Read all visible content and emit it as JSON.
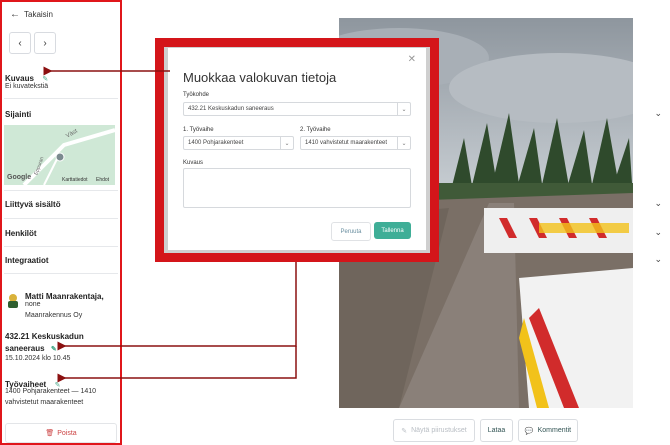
{
  "sidebar": {
    "back_label": "Takaisin",
    "kuvaus_title": "Kuvaus",
    "kuvaus_value": "Ei kuvatekstiä",
    "sijainti_title": "Sijainti",
    "map": {
      "street_label": "Väst",
      "street_label2": "Eppuran",
      "google": "Google",
      "map_data": "Karttatiedot",
      "extra": "Ehdot"
    },
    "liittyva_title": "Liittyvä sisältö",
    "henkilot_title": "Henkilöt",
    "integraatiot_title": "Integraatiot",
    "person_name": "Matti Maanrakentaja,",
    "person_role": "none",
    "company": "Maanrakennus Oy",
    "worksite": "432.21 Keskuskadun saneeraus",
    "date": "15.10.2024 klo 10.45",
    "tyovaiheet_title": "Työvaiheet",
    "tyovaiheet_value": "1400 Pohjarakenteet — 1410 vahvistetut maarakenteet",
    "delete_label": "Poista"
  },
  "modal": {
    "title": "Muokkaa valokuvan tietoja",
    "tyokohde_label": "Työkohde",
    "tyokohde_value": "432.21 Keskuskadun saneeraus",
    "vaihe1_label": "1. Työvaihe",
    "vaihe1_value": "1400 Pohjarakenteet",
    "vaihe2_label": "2. Työvaihe",
    "vaihe2_value": "1410 vahvistetut maarakenteet",
    "kuvaus_label": "Kuvaus",
    "kuvaus_value": "",
    "cancel_label": "Peruuta",
    "save_label": "Tallenna"
  },
  "bottom": {
    "show_label": "Näytä piirustukset",
    "load_label": "Lataa",
    "comment_label": "Kommentit"
  },
  "colors": {
    "accent": "#3fae97",
    "highlight": "#e0161b",
    "arrow": "#8b1010"
  }
}
